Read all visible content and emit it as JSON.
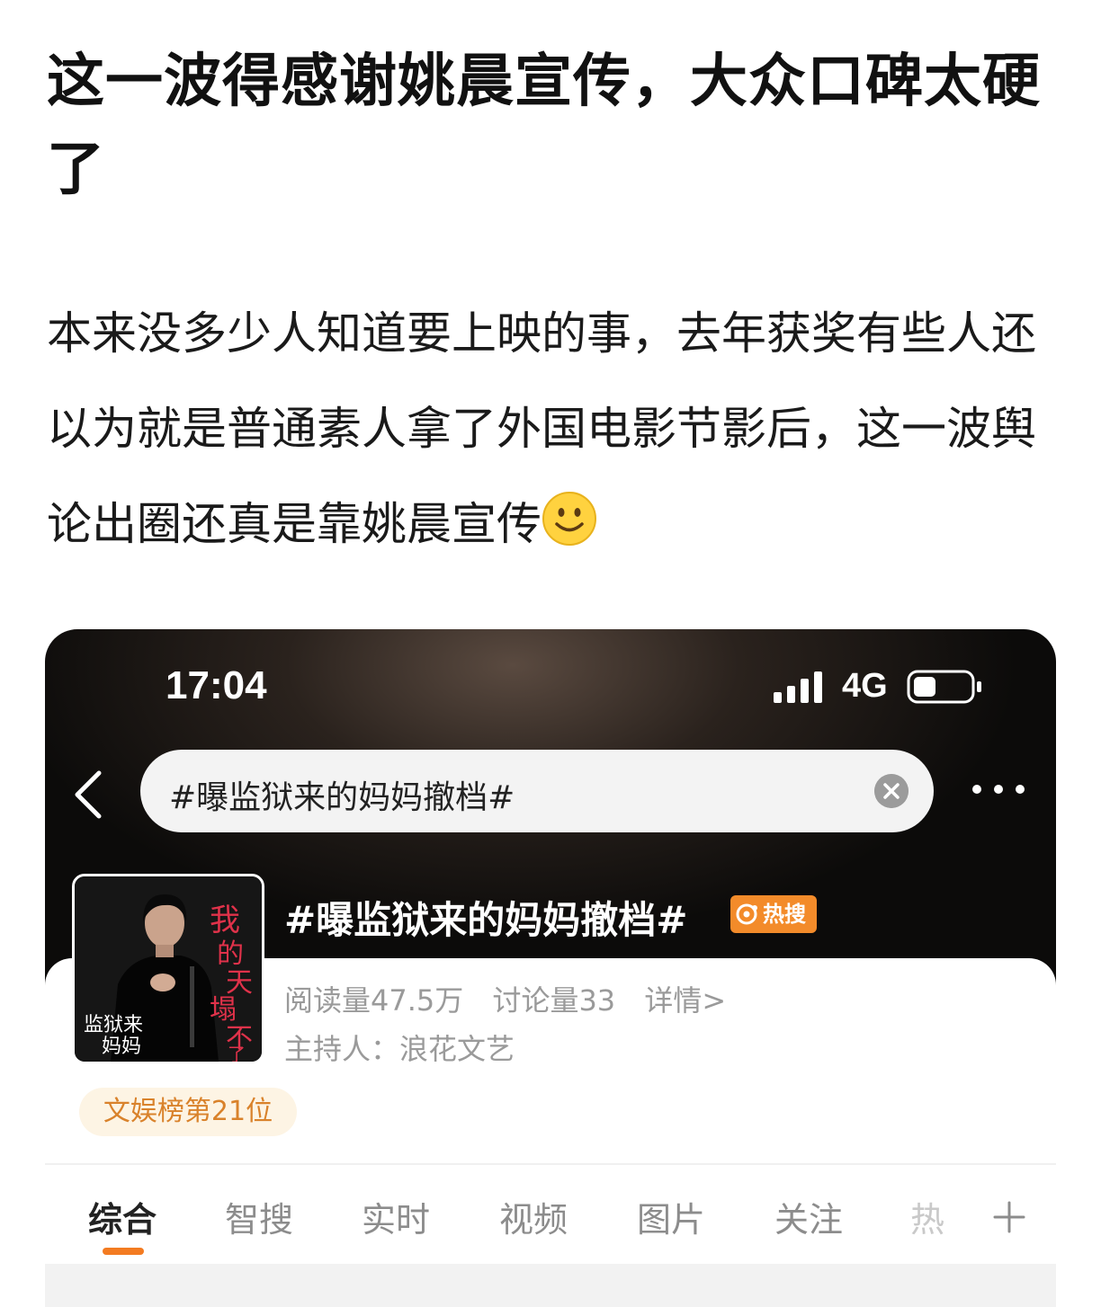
{
  "post": {
    "title": "这一波得感谢姚晨宣传，大众口碑太硬了",
    "body": "本来没多少人知道要上映的事，去年获奖有些人还以为就是普通素人拿了外国电影节影后，这一波舆论出圈还真是靠姚晨宣传"
  },
  "screenshot": {
    "status": {
      "time": "17:04",
      "network": "4G"
    },
    "search": {
      "query": "#曝监狱来的妈妈撤档#"
    },
    "topic": {
      "title": "#曝监狱来的妈妈撤档#",
      "badge": "热搜",
      "reads": "阅读量47.5万",
      "discussions": "讨论量33",
      "details": "详情>",
      "host": "主持人：浪花文艺",
      "rank": "文娱榜第21位"
    },
    "cover": {
      "title_text": "我的天塌不了",
      "film_text": "监狱来的妈妈"
    },
    "tabs": [
      "综合",
      "智搜",
      "实时",
      "视频",
      "图片",
      "关注",
      "热"
    ],
    "active_tab": "综合",
    "colors": {
      "accent": "#f37b21",
      "hot_badge": "#f38b2a",
      "rank_text": "#d9822b"
    }
  }
}
